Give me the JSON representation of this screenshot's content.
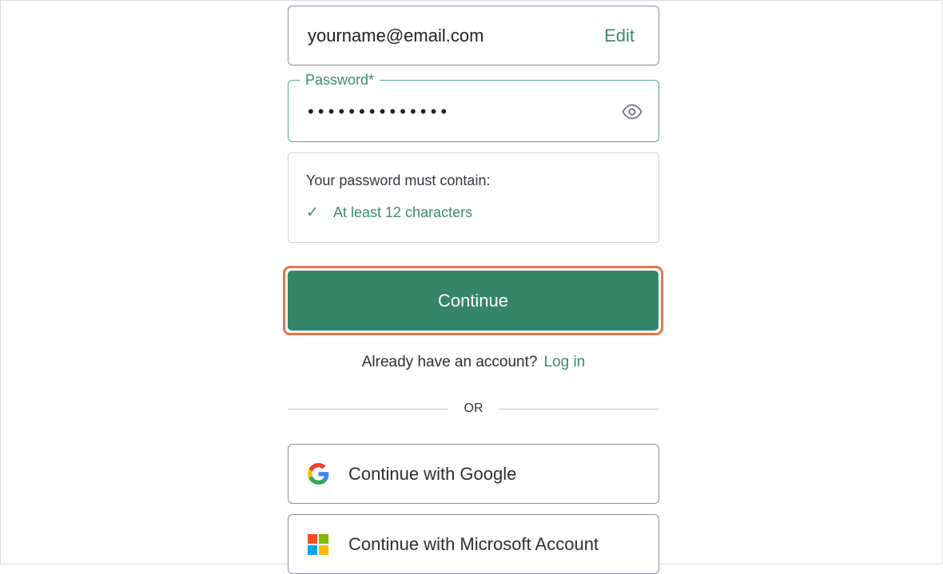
{
  "email": {
    "value": "yourname@email.com",
    "edit_label": "Edit"
  },
  "password": {
    "label": "Password*",
    "masked_value": "••••••••••••••",
    "toggle_icon": "eye-icon"
  },
  "requirements": {
    "title": "Your password must contain:",
    "items": [
      {
        "icon": "check-icon",
        "glyph": "✓",
        "text": "At least 12 characters",
        "met": true
      }
    ]
  },
  "continue_button": {
    "label": "Continue",
    "highlighted": true
  },
  "login_prompt": {
    "text": "Already have an account?",
    "link": "Log in"
  },
  "divider": {
    "text": "OR"
  },
  "social": {
    "google_label": "Continue with Google",
    "microsoft_label": "Continue with Microsoft Account"
  },
  "colors": {
    "accent": "#358669",
    "accent_text": "#3b8c6c",
    "highlight_outline": "#e8744a"
  }
}
